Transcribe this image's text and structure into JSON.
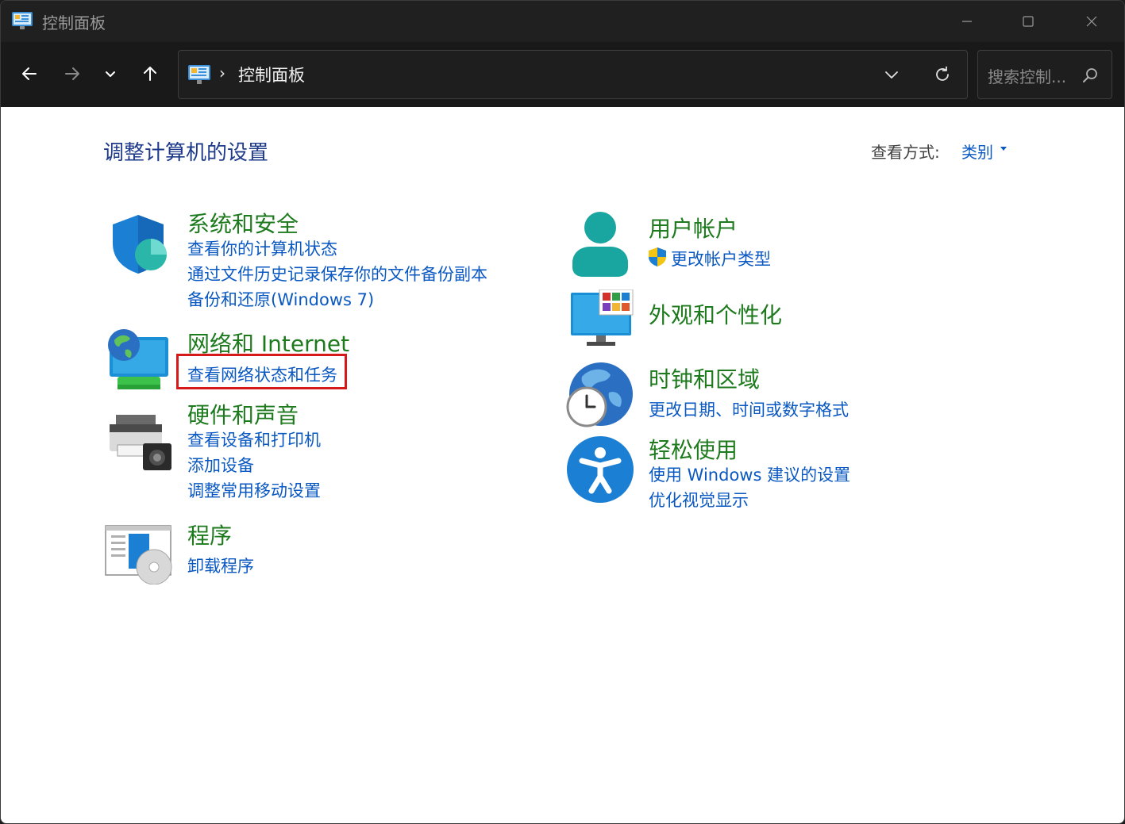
{
  "window": {
    "title": "控制面板",
    "controls": {
      "minimize": "minimize-icon",
      "maximize": "maximize-icon",
      "close": "close-icon"
    }
  },
  "nav": {
    "back": "arrow-left-icon",
    "forward": "arrow-right-icon",
    "recent": "chevron-down-icon",
    "up": "arrow-up-icon",
    "address": {
      "separator": "›",
      "path": "控制面板"
    },
    "search": {
      "placeholder": "搜索控制..."
    }
  },
  "content": {
    "title": "调整计算机的设置",
    "view_by": {
      "label": "查看方式:",
      "value": "类别"
    },
    "categories": [
      {
        "title": "系统和安全",
        "links": [
          "查看你的计算机状态",
          "通过文件历史记录保存你的文件备份副本",
          "备份和还原(Windows 7)"
        ]
      },
      {
        "title": "网络和 Internet",
        "links": [
          "查看网络状态和任务"
        ]
      },
      {
        "title": "硬件和声音",
        "links": [
          "查看设备和打印机",
          "添加设备",
          "调整常用移动设置"
        ]
      },
      {
        "title": "程序",
        "links": [
          "卸载程序"
        ]
      },
      {
        "title": "用户帐户",
        "links": [
          "更改帐户类型"
        ]
      },
      {
        "title": "外观和个性化",
        "links": []
      },
      {
        "title": "时钟和区域",
        "links": [
          "更改日期、时间或数字格式"
        ]
      },
      {
        "title": "轻松使用",
        "links": [
          "使用 Windows 建议的设置",
          "优化视觉显示"
        ]
      }
    ]
  },
  "colors": {
    "category_title": "#1d7a1d",
    "link": "#0a58c2",
    "page_title": "#1e3a8a",
    "highlight": "#d61a1a"
  }
}
